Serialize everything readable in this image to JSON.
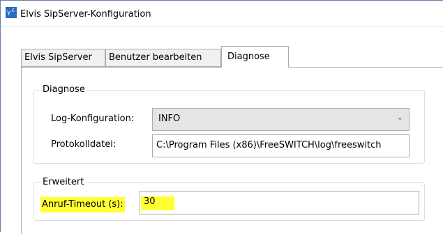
{
  "window": {
    "title": "Elvis SipServer-Konfiguration",
    "icon": "app-icon"
  },
  "tabs": [
    {
      "label": "Elvis SipServer",
      "active": false
    },
    {
      "label": "Benutzer bearbeiten",
      "active": false
    },
    {
      "label": "Diagnose",
      "active": true
    }
  ],
  "diagnose": {
    "group_label": "Diagnose",
    "log_config_label": "Log-Konfiguration:",
    "log_config_value": "INFO",
    "protokoll_label": "Protokolldatei:",
    "protokoll_value": "C:\\Program Files (x86)\\FreeSWITCH\\log\\freeswitch"
  },
  "erweitert": {
    "group_label": "Erweitert",
    "timeout_label": "Anruf-Timeout (s):",
    "timeout_value": "30"
  },
  "colors": {
    "highlight": "#ffff33",
    "border": "#acacac",
    "group_border": "#d5dfe5"
  }
}
